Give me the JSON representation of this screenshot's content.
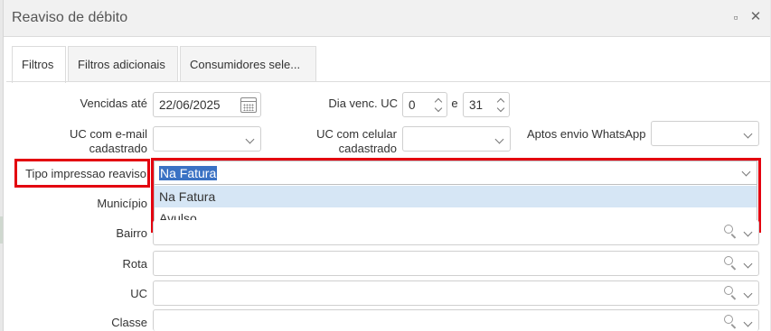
{
  "window": {
    "title": "Reaviso de débito",
    "minimize_glyph": "▫",
    "close_glyph": "✕"
  },
  "tabs": [
    {
      "label": "Filtros"
    },
    {
      "label": "Filtros adicionais"
    },
    {
      "label": "Consumidores sele..."
    }
  ],
  "filters": {
    "vencidas_label": "Vencidas até",
    "vencidas_value": "22/06/2025",
    "dia_venc_label": "Dia venc. UC",
    "dia_venc_from": "0",
    "dia_venc_sep": "e",
    "dia_venc_to": "31",
    "uc_email_label_1": "UC com e-mail",
    "uc_email_label_2": "cadastrado",
    "uc_celular_label_1": "UC com celular",
    "uc_celular_label_2": "cadastrado",
    "aptos_label": "Aptos envio WhatsApp",
    "tipo_label": "Tipo impressao reaviso",
    "tipo_value": "Na Fatura",
    "tipo_options": [
      "Na Fatura",
      "Avulso"
    ],
    "municipio_label": "Município",
    "bairro_label": "Bairro",
    "rota_label": "Rota",
    "uc_label": "UC",
    "classe_label": "Classe"
  },
  "icons": {
    "calendar": "calendar-icon",
    "search": "search-icon",
    "chevron": "chevron-down-icon",
    "spinner": "spinner-icon"
  },
  "colors": {
    "highlight_border": "#e3000f",
    "selection_bg": "#3a72c4",
    "option_selected_bg": "#d6e6f5"
  }
}
